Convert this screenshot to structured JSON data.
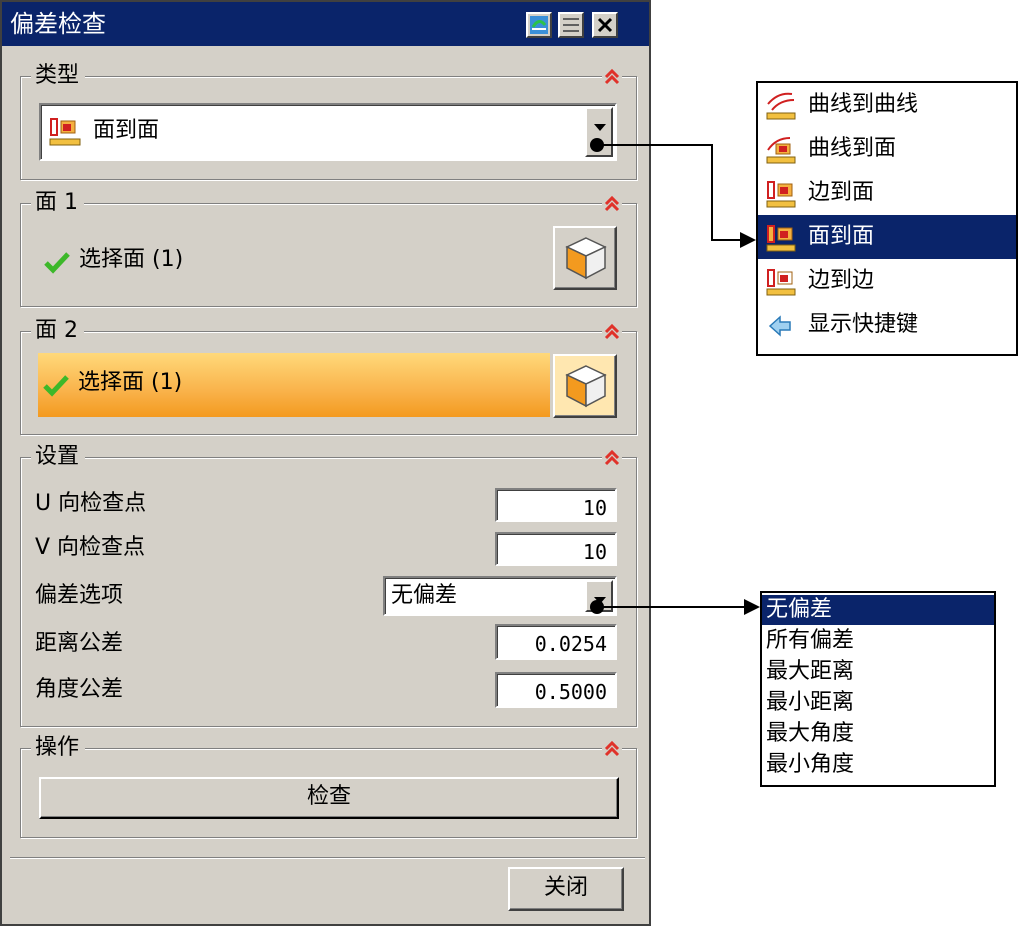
{
  "dialog": {
    "title": "偏差检查",
    "close_button_label": "关闭"
  },
  "type_group": {
    "label": "类型",
    "selected_type": "面到面"
  },
  "face1_group": {
    "label": "面 1",
    "selection_text": "选择面 (1)"
  },
  "face2_group": {
    "label": "面 2",
    "selection_text": "选择面 (1)"
  },
  "settings_group": {
    "label": "设置",
    "u_points_label": "U 向检查点",
    "u_points_value": "10",
    "v_points_label": "V 向检查点",
    "v_points_value": "10",
    "deviation_option_label": "偏差选项",
    "deviation_option_value": "无偏差",
    "distance_tolerance_label": "距离公差",
    "distance_tolerance_value": "0.0254",
    "angle_tolerance_label": "角度公差",
    "angle_tolerance_value": "0.5000"
  },
  "operation_group": {
    "label": "操作",
    "check_button_label": "检查"
  },
  "type_dropdown": {
    "items": [
      {
        "label": "曲线到曲线",
        "icon": "curve-to-curve-icon"
      },
      {
        "label": "曲线到面",
        "icon": "curve-to-face-icon"
      },
      {
        "label": "边到面",
        "icon": "edge-to-face-icon"
      },
      {
        "label": "面到面",
        "icon": "face-to-face-icon",
        "selected": true
      },
      {
        "label": "边到边",
        "icon": "edge-to-edge-icon"
      },
      {
        "label": "显示快捷键",
        "icon": "arrow-left-icon"
      }
    ]
  },
  "deviation_dropdown": {
    "items": [
      "无偏差",
      "所有偏差",
      "最大距离",
      "最小距离",
      "最大角度",
      "最小角度"
    ],
    "selected_index": 0
  },
  "colors": {
    "titlebar": "#0a246a",
    "dialog_bg": "#d4d0c8",
    "highlight_orange": "#f39a1f",
    "collapse_red": "#e0322a",
    "check_green": "#3db82a"
  }
}
